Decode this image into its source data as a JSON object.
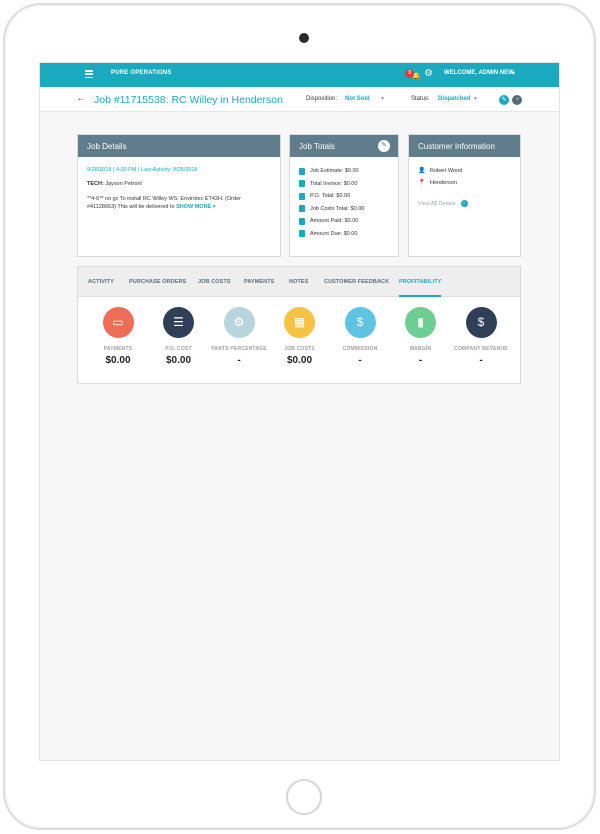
{
  "app": {
    "brand": "PURE OPERATIONS",
    "notification_count": "3",
    "welcome": "WELCOME, ADMIN NEW",
    "accent_color": "#1aa9bf",
    "header_color": "#607d8b"
  },
  "job": {
    "title": "Job #11715538: RC Willey in Henderson",
    "disposition_label": "Disposition:",
    "disposition_value": "Not Sold",
    "status_label": "Status:",
    "status_value": "Dispatched"
  },
  "job_details": {
    "header": "Job Details",
    "meta": "9/28/2018 | 4:00 PM | Last Activity: 9/28/2018",
    "tech_label": "TECH:",
    "tech_name": "Jayson Petroni",
    "description": "**4-6** no gc To install RC Willey WS: Envirotec ET42H. (Order #41128663) This will be delivered to",
    "show_more": "SHOW MORE"
  },
  "job_totals": {
    "header": "Job Totals",
    "rows": [
      "Job Estimate: $0.00",
      "Total Invoice: $0.00",
      "P.O. Total: $0.00",
      "Job Costs Total: $0.00",
      "Amount Paid: $0.00",
      "Amount Due: $0.00"
    ]
  },
  "customer": {
    "header": "Customer Information",
    "name": "Robert Wood",
    "location": "Henderson",
    "view_all": "View All Details"
  },
  "tabs": [
    "ACTIVITY",
    "PURCHASE ORDERS",
    "JOB COSTS",
    "PAYMENTS",
    "NOTES",
    "CUSTOMER FEEDBACK",
    "PROFITABILITY"
  ],
  "active_tab": "PROFITABILITY",
  "metrics": [
    {
      "label": "PAYMENTS",
      "value": "$0.00",
      "icon": "credit-card-icon",
      "color": "#ef6c57"
    },
    {
      "label": "P.O. COST",
      "value": "$0.00",
      "icon": "clipboard-icon",
      "color": "#2f3f55"
    },
    {
      "label": "PARTS PERCENTAGE",
      "value": "-",
      "icon": "gears-icon",
      "color": "#b8d4dc"
    },
    {
      "label": "JOB COSTS",
      "value": "$0.00",
      "icon": "calculator-icon",
      "color": "#f5c244"
    },
    {
      "label": "COMMISSION",
      "value": "-",
      "icon": "dollar-document-icon",
      "color": "#5fc3e4"
    },
    {
      "label": "MARGIN",
      "value": "-",
      "icon": "bar-chart-icon",
      "color": "#6ccf91"
    },
    {
      "label": "COMPANY REVENUE",
      "value": "-",
      "icon": "presentation-board-icon",
      "color": "#2f3f55"
    }
  ]
}
